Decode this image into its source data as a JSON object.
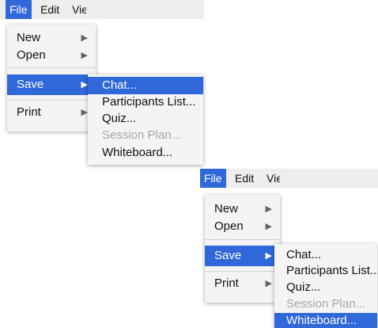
{
  "colors": {
    "highlight": "#3067d9",
    "menu_background": "#f4f4f4",
    "disabled_text": "#a8a8a8"
  },
  "icons": {
    "submenu_arrow": "triangle-right-icon"
  },
  "menus": [
    {
      "menubar": {
        "file": "File",
        "edit": "Edit",
        "view": "Vie"
      },
      "file_menu": {
        "new": "New",
        "open": "Open",
        "save": "Save",
        "print": "Print",
        "highlighted": "Save"
      },
      "save_submenu": {
        "chat": "Chat...",
        "participants_list": "Participants List...",
        "quiz": "Quiz...",
        "session_plan": "Session Plan...",
        "whiteboard": "Whiteboard...",
        "highlighted": "Chat...",
        "disabled": [
          "Session Plan..."
        ]
      }
    },
    {
      "menubar": {
        "file": "File",
        "edit": "Edit",
        "view": "Vie"
      },
      "file_menu": {
        "new": "New",
        "open": "Open",
        "save": "Save",
        "print": "Print",
        "highlighted": "Save"
      },
      "save_submenu": {
        "chat": "Chat...",
        "participants_list": "Participants List...",
        "quiz": "Quiz...",
        "session_plan": "Session Plan...",
        "whiteboard": "Whiteboard...",
        "highlighted": "Whiteboard...",
        "disabled": [
          "Session Plan..."
        ]
      }
    }
  ]
}
